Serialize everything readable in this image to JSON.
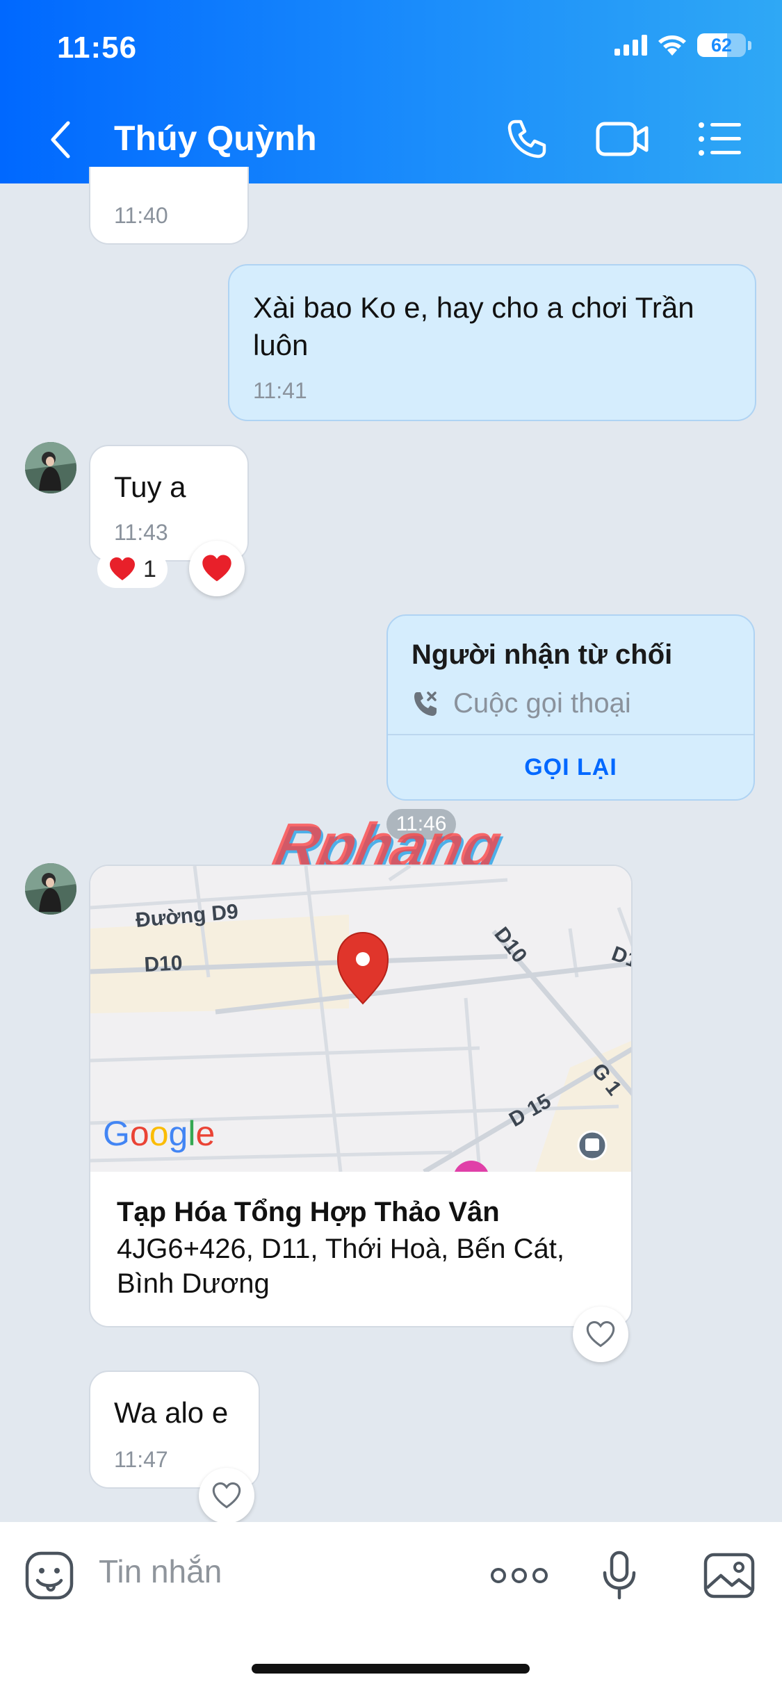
{
  "status_bar": {
    "time": "11:56",
    "battery": "62",
    "battery_level": 0.62
  },
  "header": {
    "contact_name": "Thúy Quỳnh"
  },
  "messages": {
    "partial_time": "11:40",
    "sent_1": {
      "text": "Xài bao Ko e, hay cho a chơi Trần luôn",
      "time": "11:41"
    },
    "received_1": {
      "text": "Tuy a",
      "time": "11:43",
      "reaction_count": "1"
    },
    "call": {
      "title": "Người nhận từ chối",
      "subtitle": "Cuộc gọi thoại",
      "action": "GỌI LẠI"
    },
    "time_divider": "11:46",
    "location": {
      "map_labels": {
        "road_d9": "Đường D9",
        "road_d10_left": "D10",
        "road_d10_right": "D10",
        "road_d15": "D 15",
        "road_g1": "G 1",
        "road_d1": "D1",
        "google": "Google"
      },
      "place_name": "Tạp Hóa Tổng Hợp Thảo Vân",
      "address": "4JG6+426, D11, Thới Hoà, Bến Cát, Bình Dương"
    },
    "received_2": {
      "text": "Wa alo e",
      "time": "11:47"
    }
  },
  "watermark": "Rphang",
  "input": {
    "placeholder": "Tin nhắn"
  },
  "colors": {
    "header_start": "#0068ff",
    "header_end": "#2fa8f5",
    "sent_bubble": "#d5edfd",
    "chat_bg": "#e2e8ef",
    "accent": "#0068ff",
    "heart": "#e8202a"
  }
}
